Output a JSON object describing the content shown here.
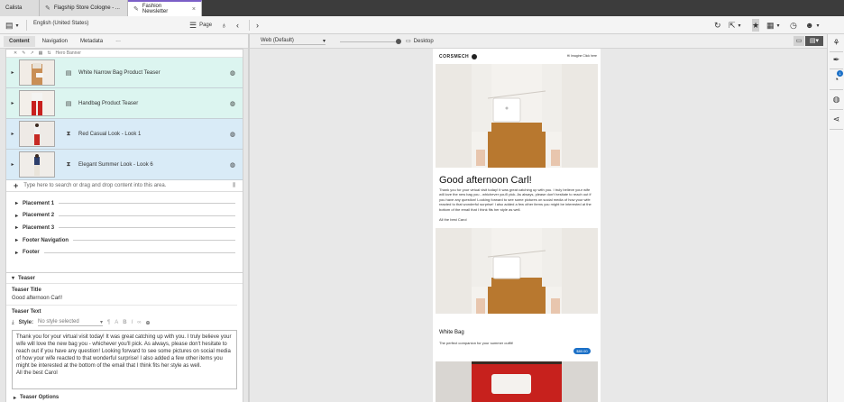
{
  "tabs": [
    {
      "label": "Calista"
    },
    {
      "label": "Flagship Store Cologne - ..."
    },
    {
      "label": "Fashion Newsletter"
    }
  ],
  "toolbar": {
    "locale": "English (United States)",
    "page_label": "Page"
  },
  "left": {
    "subtabs": [
      "Content",
      "Navigation",
      "Metadata",
      "···"
    ],
    "mini_toolbar_label": "Hero Banner",
    "items": [
      {
        "label": "White Narrow Bag Product Teaser"
      },
      {
        "label": "Handbag Product Teaser"
      },
      {
        "label": "Red Casual Look - Look 1"
      },
      {
        "label": "Elegant Summer Look - Look 6"
      }
    ],
    "add_placeholder": "Type here to search or drag and drop content into this area.",
    "placements": [
      "Placement 1",
      "Placement 2",
      "Placement 3",
      "Footer Navigation",
      "Footer"
    ]
  },
  "teaser": {
    "section": "Teaser",
    "title_label": "Teaser Title",
    "title_value": "Good afternoon Carl!",
    "text_label": "Teaser Text",
    "style_label": "Style:",
    "style_placeholder": "No style selected",
    "text_value": "Thank you for your virtual visit today! It was great catching up with you. I truly believe your\nwife will love the new bag you - whichever you'll pick. As always, please don't hesitate to\nreach out if you have any question! Looking forward to see some pictures on social media\nof how your wife reacted to that wonderful surprise! I also added a few other items you\nmight be interested at the bottom of the email that I think fits her style as well.\nAll the best Carol",
    "options_label": "Teaser Options"
  },
  "preview": {
    "device": "Web (Default)",
    "device_label": "Desktop"
  },
  "email": {
    "brand": "CORSMECH",
    "top_link": "Hi Imagine Click here",
    "greeting": "Good afternoon Carl!",
    "body": "Thank you for your virtual visit today! It was great catching up with you. I truly believe your wife will love the new bag you - whichever you'll pick. As always, please don't hesitate to reach out if you have any question! Looking forward to see some pictures on social media of how your wife reacted to that wonderful surprise! I also added a few other items you might be interested at the bottom of the email that I think fits her style as well.",
    "sign": "All the best Carol",
    "product_title": "White Bag",
    "product_sub": "The perfect companion for your summer outfit!",
    "price": "$80.00"
  },
  "colors": {
    "accent": "#7b5fc7",
    "row_green": "#dcf5f0",
    "row_blue": "#d9ebf7",
    "price_blue": "#1b70c7"
  }
}
